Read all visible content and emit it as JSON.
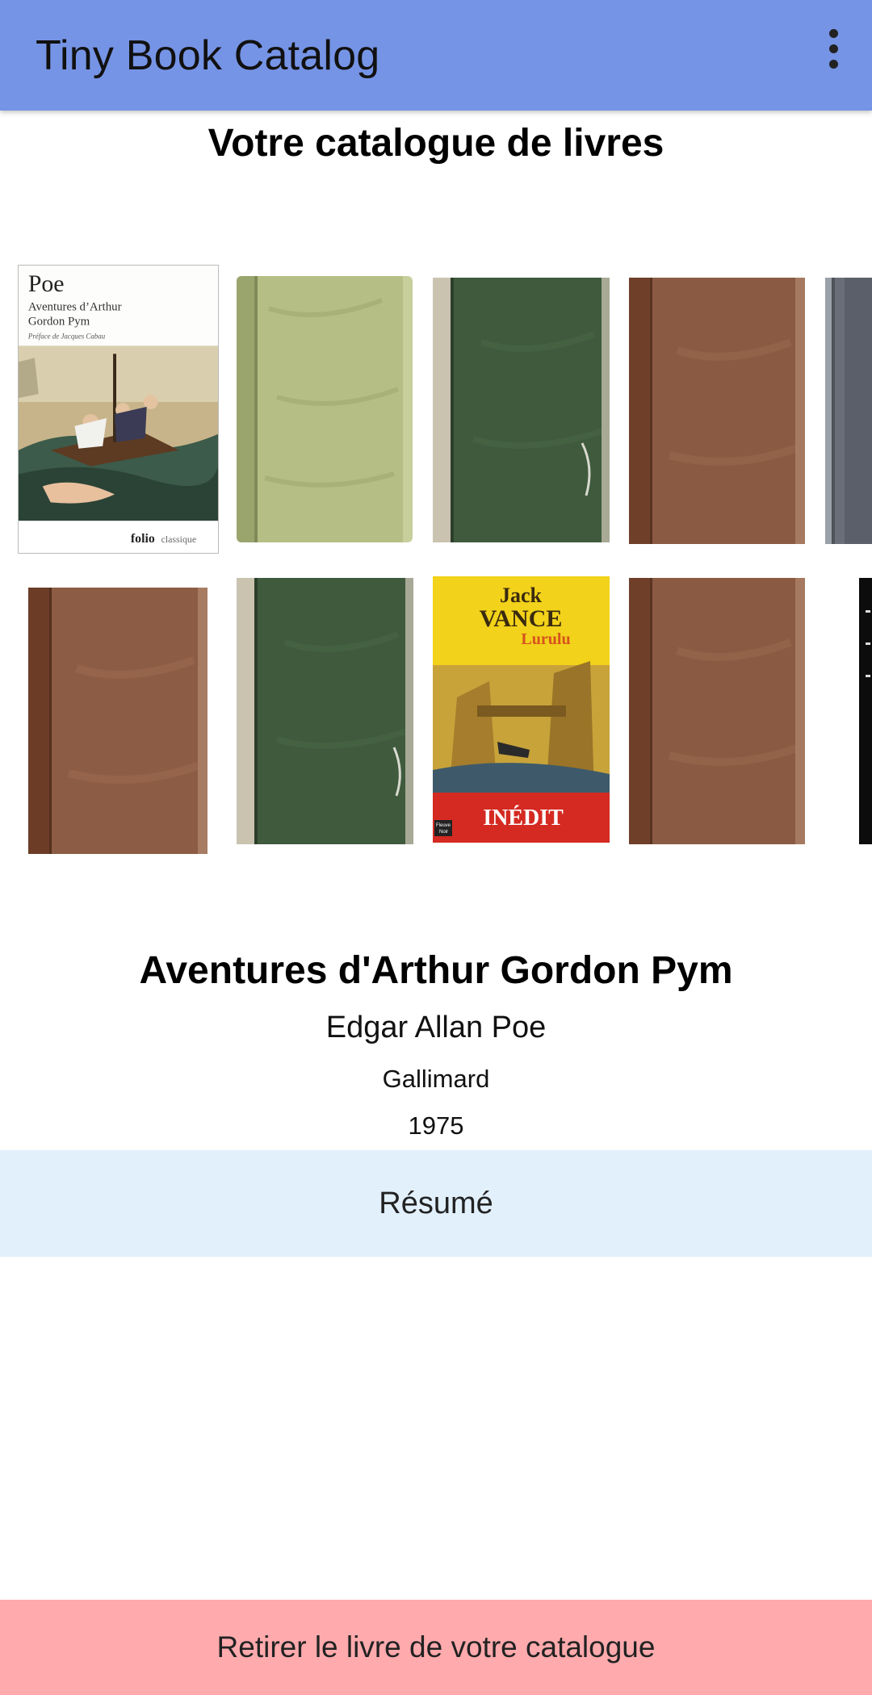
{
  "appbar": {
    "title": "Tiny Book Catalog",
    "menu_icon": "more-vert-icon"
  },
  "page": {
    "heading": "Votre catalogue de livres"
  },
  "covers": {
    "poe": {
      "author": "Poe",
      "title_line1": "Aventures d’Arthur",
      "title_line2": "Gordon Pym",
      "preface": "Préface de Jacques Cabau",
      "collection": "folio",
      "collection_suffix": "classique"
    },
    "vance": {
      "author_first": "Jack",
      "author_last": "VANCE",
      "title": "Lurulu",
      "banner": "INÉDIT",
      "publisher_logo_1": "Fleuve",
      "publisher_logo_2": "Noir"
    }
  },
  "selected_book": {
    "title": "Aventures d'Arthur Gordon Pym",
    "author": "Edgar Allan Poe",
    "publisher": "Gallimard",
    "year": "1975"
  },
  "actions": {
    "resume_label": "Résumé",
    "remove_label": "Retirer le livre de votre catalogue"
  },
  "colors": {
    "appbar": "#7694e6",
    "resume_bg": "#e2f0fc",
    "remove_bg": "#ffaaad",
    "cover_green": "#3f5a3d",
    "cover_olive": "#b5bf85",
    "cover_brown": "#8a5a42",
    "cover_vance_yellow": "#f2d21a",
    "cover_vance_red": "#d42a22"
  }
}
